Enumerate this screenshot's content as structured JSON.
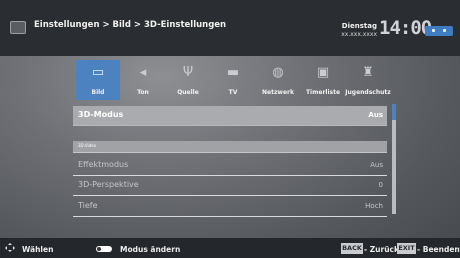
{
  "header": {
    "breadcrumb": "Einstellungen > Bild > 3D-Einstellungen",
    "day": "Dienstag",
    "date": "xx.xxx.xxxx",
    "time": "14:00"
  },
  "tabs": [
    {
      "label": "Bild",
      "icon": "monitor-icon",
      "active": true
    },
    {
      "label": "Ton",
      "icon": "speaker-icon",
      "active": false
    },
    {
      "label": "Quelle",
      "icon": "antenna-icon",
      "active": false
    },
    {
      "label": "TV",
      "icon": "tv-icon",
      "active": false
    },
    {
      "label": "Netzwerk",
      "icon": "globe-icon",
      "active": false
    },
    {
      "label": "Timerliste",
      "icon": "calendar-icon",
      "active": false
    },
    {
      "label": "Jugendschutz",
      "icon": "parental-icon",
      "active": false
    }
  ],
  "menu": {
    "mode": {
      "label": "3D-Modus",
      "value": "Aus"
    },
    "section": "3D-Video",
    "rows": [
      {
        "label": "Effektmodus",
        "value": "Aus"
      },
      {
        "label": "3D-Perspektive",
        "value": "0"
      },
      {
        "label": "Tiefe",
        "value": "Hoch"
      }
    ]
  },
  "footer": {
    "select": "Wählen",
    "change": "Modus ändern",
    "back_key": "BACK",
    "back": "Zurück",
    "exit_key": "EXIT",
    "exit": "Beenden"
  },
  "colors": {
    "accent": "#4d82c0",
    "topbar": "#2a2d31",
    "highlight_row": "#a9abae"
  }
}
